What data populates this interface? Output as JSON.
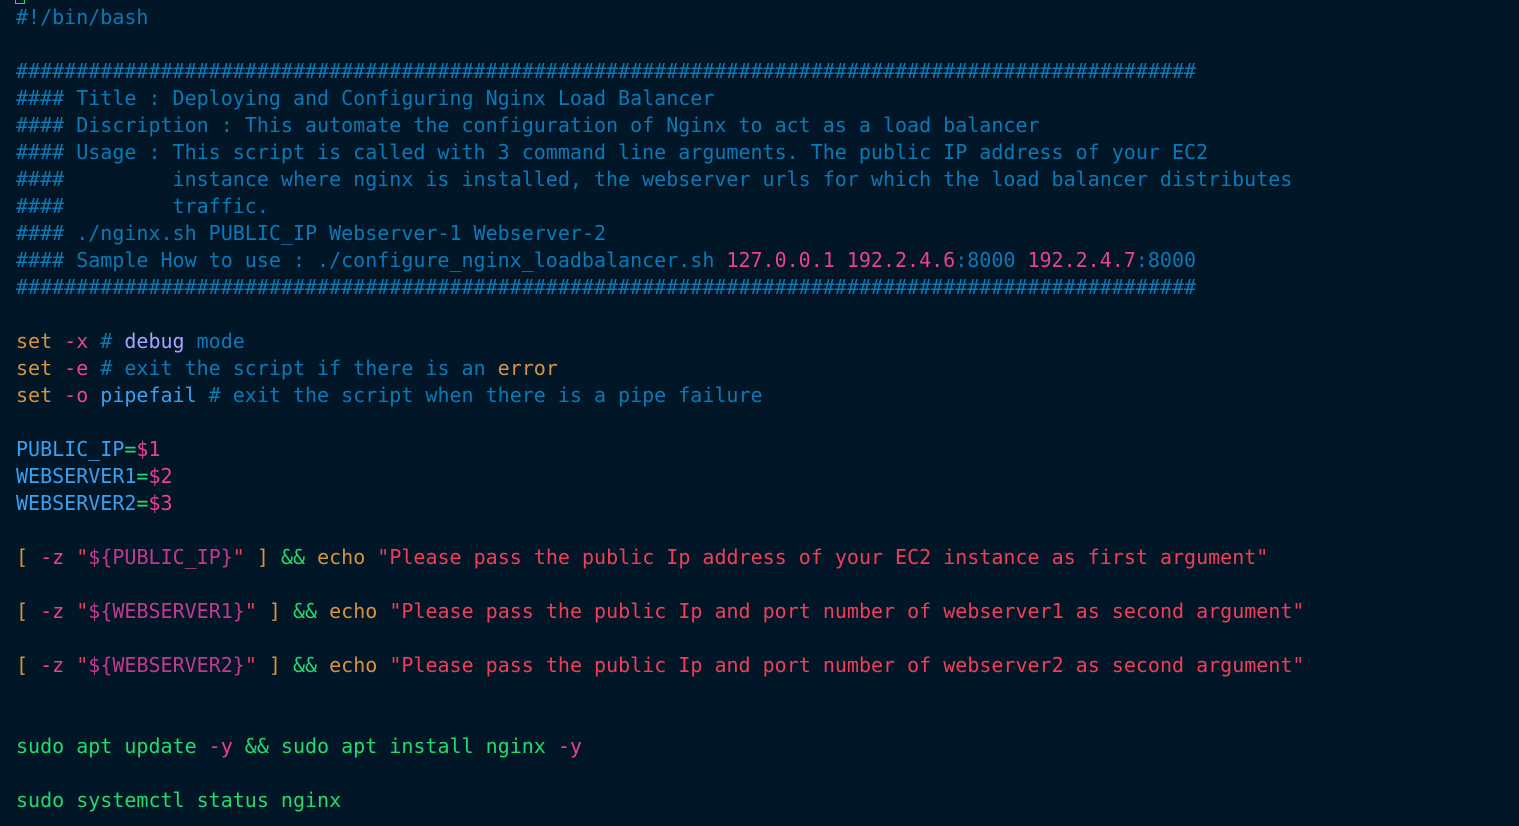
{
  "colors": {
    "background": "#011627",
    "comment": "#0a7ab6",
    "comment_number": "#e94292",
    "builtin": "#d6933f",
    "flag": "#e94292",
    "keyword_purple": "#a9a0ff",
    "variable": "#3aa0f0",
    "operator": "#22da6e",
    "string": "#f03e59",
    "interpolation": "#c23a8f",
    "command": "#22da6e"
  },
  "editor": {
    "language": "bash",
    "lines": [
      [
        {
          "t": "#!/bin/bash",
          "c": "comment"
        }
      ],
      [],
      [
        {
          "t": "##################################################################################################",
          "c": "comment"
        }
      ],
      [
        {
          "t": "#### Title : Deploying and Configuring Nginx Load Balancer",
          "c": "comment"
        }
      ],
      [
        {
          "t": "#### Discription : This automate the configuration of Nginx to act as a load balancer",
          "c": "comment"
        }
      ],
      [
        {
          "t": "#### Usage : This script is called with 3 command line arguments. The public IP address of your EC2",
          "c": "comment"
        }
      ],
      [
        {
          "t": "####         instance where nginx is installed, the webserver urls for which the load balancer distributes",
          "c": "comment"
        }
      ],
      [
        {
          "t": "####         traffic.",
          "c": "comment"
        }
      ],
      [
        {
          "t": "#### ./nginx.sh PUBLIC_IP Webserver-1 Webserver-2",
          "c": "comment"
        }
      ],
      [
        {
          "t": "#### Sample How to use : ./configure_nginx_loadbalancer.sh ",
          "c": "comment"
        },
        {
          "t": "127.0.0.1",
          "c": "comment_number"
        },
        {
          "t": " ",
          "c": "comment"
        },
        {
          "t": "192.2.4.6",
          "c": "comment_number"
        },
        {
          "t": ":8000 ",
          "c": "comment"
        },
        {
          "t": "192.2.4.7",
          "c": "comment_number"
        },
        {
          "t": ":8000",
          "c": "comment"
        }
      ],
      [
        {
          "t": "##################################################################################################",
          "c": "comment"
        }
      ],
      [],
      [
        {
          "t": "set",
          "c": "builtin"
        },
        {
          "t": " -x",
          "c": "flag"
        },
        {
          "t": " # ",
          "c": "comment"
        },
        {
          "t": "debug",
          "c": "keyword_purple"
        },
        {
          "t": " mode",
          "c": "comment"
        }
      ],
      [
        {
          "t": "set",
          "c": "builtin"
        },
        {
          "t": " -e",
          "c": "flag"
        },
        {
          "t": " # exit the script if there is an ",
          "c": "comment"
        },
        {
          "t": "error",
          "c": "builtin"
        }
      ],
      [
        {
          "t": "set",
          "c": "builtin"
        },
        {
          "t": " -o ",
          "c": "flag"
        },
        {
          "t": "pipefail",
          "c": "variable"
        },
        {
          "t": " # exit the script when there is a pipe failure",
          "c": "comment"
        }
      ],
      [],
      [
        {
          "t": "PUBLIC_IP",
          "c": "variable"
        },
        {
          "t": "=",
          "c": "operator"
        },
        {
          "t": "$1",
          "c": "flag"
        }
      ],
      [
        {
          "t": "WEBSERVER1",
          "c": "variable"
        },
        {
          "t": "=",
          "c": "operator"
        },
        {
          "t": "$2",
          "c": "flag"
        }
      ],
      [
        {
          "t": "WEBSERVER2",
          "c": "variable"
        },
        {
          "t": "=",
          "c": "operator"
        },
        {
          "t": "$3",
          "c": "flag"
        }
      ],
      [],
      [
        {
          "t": "[ ",
          "c": "builtin"
        },
        {
          "t": "-z",
          "c": "flag"
        },
        {
          "t": " \"",
          "c": "string"
        },
        {
          "t": "${PUBLIC_IP}",
          "c": "interpolation"
        },
        {
          "t": "\"",
          "c": "string"
        },
        {
          "t": " ] ",
          "c": "builtin"
        },
        {
          "t": "&&",
          "c": "operator"
        },
        {
          "t": " echo ",
          "c": "builtin"
        },
        {
          "t": "\"Please pass the public Ip address of your EC2 instance as first argument\"",
          "c": "string"
        }
      ],
      [],
      [
        {
          "t": "[ ",
          "c": "builtin"
        },
        {
          "t": "-z",
          "c": "flag"
        },
        {
          "t": " \"",
          "c": "string"
        },
        {
          "t": "${WEBSERVER1}",
          "c": "interpolation"
        },
        {
          "t": "\"",
          "c": "string"
        },
        {
          "t": " ] ",
          "c": "builtin"
        },
        {
          "t": "&&",
          "c": "operator"
        },
        {
          "t": " echo ",
          "c": "builtin"
        },
        {
          "t": "\"Please pass the public Ip and port number of webserver1 as second argument\"",
          "c": "string"
        }
      ],
      [],
      [
        {
          "t": "[ ",
          "c": "builtin"
        },
        {
          "t": "-z",
          "c": "flag"
        },
        {
          "t": " \"",
          "c": "string"
        },
        {
          "t": "${WEBSERVER2}",
          "c": "interpolation"
        },
        {
          "t": "\"",
          "c": "string"
        },
        {
          "t": " ] ",
          "c": "builtin"
        },
        {
          "t": "&&",
          "c": "operator"
        },
        {
          "t": " echo ",
          "c": "builtin"
        },
        {
          "t": "\"Please pass the public Ip and port number of webserver2 as second argument\"",
          "c": "string"
        }
      ],
      [],
      [],
      [
        {
          "t": "sudo apt update ",
          "c": "command"
        },
        {
          "t": "-y",
          "c": "flag"
        },
        {
          "t": " && ",
          "c": "operator"
        },
        {
          "t": "sudo apt install nginx ",
          "c": "command"
        },
        {
          "t": "-y",
          "c": "flag"
        }
      ],
      [],
      [
        {
          "t": "sudo systemctl status nginx",
          "c": "command"
        }
      ]
    ]
  }
}
